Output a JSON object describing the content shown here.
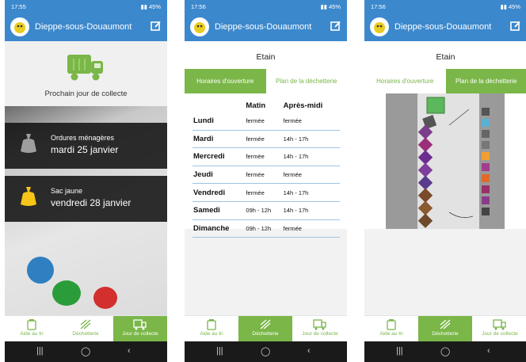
{
  "app_title": "Dieppe-sous-Douaumont",
  "screens": [
    {
      "status_time": "17:55",
      "status_battery": "45%",
      "next_collection_label": "Prochain jour de collecte",
      "collections": [
        {
          "type": "Ordures ménagères",
          "date": "mardi 25 janvier"
        },
        {
          "type": "Sac jaune",
          "date": "vendredi 28 janvier"
        }
      ]
    },
    {
      "status_time": "17:56",
      "status_battery": "45%",
      "site_name": "Etain",
      "tabs": [
        "Horaires d'ouverture",
        "Plan de la déchetterie"
      ],
      "hours_headers": [
        "",
        "Matin",
        "Après-midi"
      ],
      "hours": [
        {
          "day": "Lundi",
          "morning": "fermée",
          "afternoon": "fermée"
        },
        {
          "day": "Mardi",
          "morning": "fermée",
          "afternoon": "14h - 17h"
        },
        {
          "day": "Mercredi",
          "morning": "fermée",
          "afternoon": "14h - 17h"
        },
        {
          "day": "Jeudi",
          "morning": "fermée",
          "afternoon": "fermée"
        },
        {
          "day": "Vendredi",
          "morning": "fermée",
          "afternoon": "14h - 17h"
        },
        {
          "day": "Samedi",
          "morning": "09h - 12h",
          "afternoon": "14h - 17h"
        },
        {
          "day": "Dimanche",
          "morning": "09h - 12h",
          "afternoon": "fermée"
        }
      ]
    },
    {
      "status_time": "17:56",
      "status_battery": "45%",
      "site_name": "Etain",
      "tabs": [
        "Horaires d'ouverture",
        "Plan de la déchetterie"
      ]
    }
  ],
  "nav": [
    "Aide au tri",
    "Déchetterie",
    "Jour de collecte"
  ],
  "colors": {
    "blue": "#3c88cd",
    "green": "#7ab648"
  }
}
